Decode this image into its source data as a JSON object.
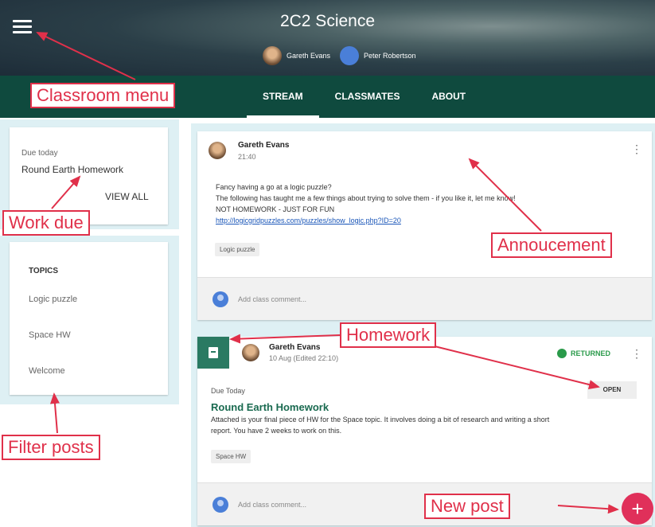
{
  "header": {
    "menu_icon": "hamburger-menu-icon",
    "class_title": "2C2 Science",
    "teachers": [
      "Gareth Evans",
      "Peter Robertson"
    ],
    "tabs": [
      "STREAM",
      "CLASSMATES",
      "ABOUT"
    ],
    "active_tab": "STREAM"
  },
  "sidebar": {
    "due_label": "Due today",
    "due_item": "Round Earth Homework",
    "view_all": "VIEW ALL",
    "topics_heading": "TOPICS",
    "topics": [
      "Logic puzzle",
      "Space HW",
      "Welcome"
    ]
  },
  "announcement": {
    "author": "Gareth Evans",
    "time": "21:40",
    "lines": [
      "Fancy having a go at a logic puzzle?",
      "The following has taught me a few things about trying to solve them - if you like it, let me know!",
      "NOT HOMEWORK - JUST FOR FUN"
    ],
    "link": "http://logicgridpuzzles.com/puzzles/show_logic.php?ID=20",
    "chip": "Logic puzzle",
    "comment_placeholder": "Add class comment..."
  },
  "homework": {
    "author": "Gareth Evans",
    "time": "10 Aug (Edited 22:10)",
    "status": "RETURNED",
    "due": "Due Today",
    "title": "Round Earth Homework",
    "desc_lines": [
      "Attached is your final piece of HW for the Space topic. It involves doing a bit of research and writing a short",
      "report. You have 2 weeks to work on this."
    ],
    "open_label": "OPEN",
    "chip": "Space HW",
    "comment_placeholder": "Add class comment..."
  },
  "fab_label": "+",
  "callouts": {
    "classroom_menu": "Classroom menu",
    "work_due": "Work due",
    "filter_posts": "Filter posts",
    "announcement": "Annoucement",
    "homework": "Homework",
    "new_post": "New post"
  },
  "colors": {
    "header_green": "#0f4a3e",
    "accent_red": "#e0304a",
    "panel_blue": "#def0f4",
    "homework_green": "#2a7a62",
    "fab_pink": "#e0305a"
  }
}
